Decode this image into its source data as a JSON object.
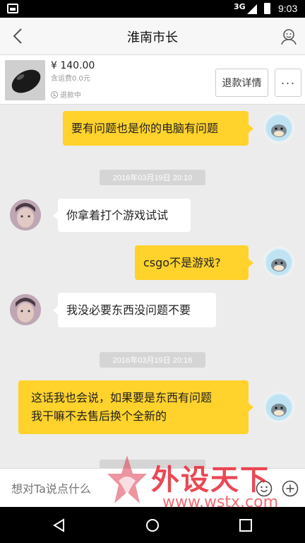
{
  "status_bar": {
    "network": "3G",
    "time": "9:03"
  },
  "header": {
    "title": "淮南市长"
  },
  "order": {
    "price": "¥ 140.00",
    "shipping": "含运费0.0元",
    "status": "退款中",
    "refund_button": "退款详情",
    "more_button": "···"
  },
  "messages": [
    {
      "from": "me",
      "text": "要有问题也是你的电脑有问题"
    },
    {
      "from": "timestamp",
      "text": "2016年03月19日 20:10"
    },
    {
      "from": "them",
      "text": "你拿着打个游戏试试"
    },
    {
      "from": "me",
      "text": "csgo不是游戏?"
    },
    {
      "from": "them",
      "text": "我没必要东西没问题不要"
    },
    {
      "from": "timestamp",
      "text": "2016年03月19日 20:16"
    },
    {
      "from": "me",
      "lines": [
        "这话我也会说，如果要是东西有问题",
        "我干嘛不去售后换个全新的"
      ]
    }
  ],
  "input": {
    "placeholder": "想对Ta说点什么"
  },
  "watermark": {
    "main": "外设天下",
    "sub": "www.wstx.com"
  },
  "colors": {
    "me_bubble": "#ffd22c",
    "them_bubble": "#ffffff",
    "background": "#ececec"
  }
}
